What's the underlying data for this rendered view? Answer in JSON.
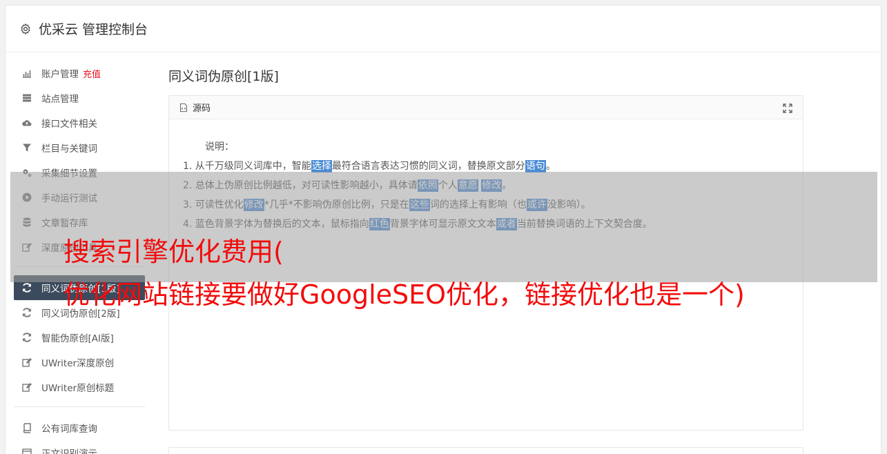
{
  "header": {
    "title": "优采云 管理控制台"
  },
  "sidebar": {
    "group1": [
      {
        "label": "账户管理",
        "badge": "充值",
        "icon": "bar-chart-icon"
      },
      {
        "label": "站点管理",
        "icon": "server-icon"
      },
      {
        "label": "接口文件相关",
        "icon": "cloud-upload-icon"
      },
      {
        "label": "栏目与关键词",
        "icon": "filter-icon"
      },
      {
        "label": "采集细节设置",
        "icon": "cogs-icon"
      },
      {
        "label": "手动运行测试",
        "icon": "play-circle-icon"
      },
      {
        "label": "文章暂存库",
        "icon": "database-icon"
      },
      {
        "label": "深度原创工具",
        "icon": "edit-icon"
      }
    ],
    "group2": [
      {
        "label": "同义词伪原创[1版]",
        "icon": "refresh-icon",
        "active": true
      },
      {
        "label": "同义词伪原创[2版]",
        "icon": "refresh-icon"
      },
      {
        "label": "智能伪原创[AI版]",
        "icon": "refresh-icon"
      },
      {
        "label": "UWriter深度原创",
        "icon": "edit-icon"
      },
      {
        "label": "UWriter原创标题",
        "icon": "edit-icon"
      }
    ],
    "group3": [
      {
        "label": "公有词库查询",
        "icon": "book-icon"
      },
      {
        "label": "正文识别演示",
        "icon": "window-icon"
      }
    ]
  },
  "main": {
    "title": "同义词伪原创[1版]",
    "panel": {
      "header": "源码",
      "lead": "说明：",
      "lines": [
        [
          "1. 从千万级同义词库中，智能",
          {
            "hl": "选择"
          },
          "最符合语言表达习惯的同义词，替换原文部分",
          {
            "hl": "语句"
          },
          "。"
        ],
        [
          "2. 总体上伪原创比例越低，对可读性影响越小，具体请",
          {
            "hl": "依照"
          },
          "个人",
          {
            "hl": "意愿"
          },
          " ",
          {
            "hl": "修改"
          },
          "。"
        ],
        [
          "3. 可读性优化",
          {
            "hl": "修改"
          },
          "*几乎*不影响伪原创比例，只是在",
          {
            "hl": "这些"
          },
          "词的选择上有影响（也",
          {
            "hl": "或许"
          },
          "没影响）。"
        ],
        [
          "4. 蓝色背景字体为替换后的文本，鼠标指向",
          {
            "hl": "红色"
          },
          "背景字体可显示原文文本",
          {
            "hl": "或者"
          },
          "当前替换词语的上下文契合度。"
        ]
      ]
    }
  },
  "overlay": {
    "line1": "搜索引擎优化费用(",
    "line2": "优化网站链接要做好GoogleSEO优化，链接优化也是一个)"
  },
  "colors": {
    "active_bg": "#3b4a5c",
    "highlight": "#4a8bd4",
    "overlay_text": "#f20c0c",
    "badge": "#e8121b"
  }
}
